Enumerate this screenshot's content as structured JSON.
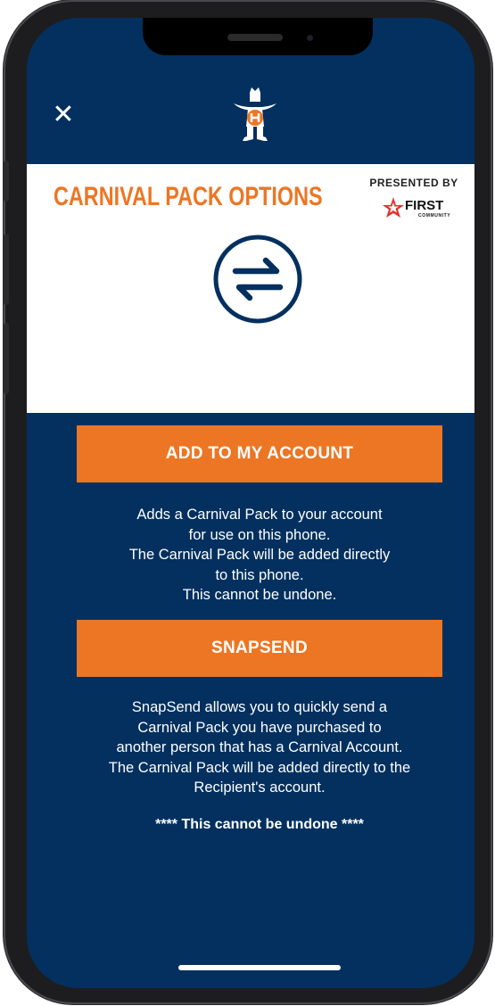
{
  "header": {
    "close_symbol": "✕"
  },
  "panel": {
    "title": "CARNIVAL PACK OPTIONS",
    "presented_by": "PRESENTED BY",
    "sponsor_name": "FIRST",
    "sponsor_sub": "COMMUNITY"
  },
  "add_to_account": {
    "button_label": "ADD TO MY ACCOUNT",
    "description": [
      "Adds a Carnival Pack to your account",
      "for use on this phone.",
      "The Carnival Pack will be added directly",
      "to this phone.",
      "This cannot be undone."
    ]
  },
  "snapsend": {
    "button_label": "SNAPSEND",
    "description": [
      "SnapSend allows you to quickly send a",
      "Carnival Pack you have purchased to",
      "another person that has a Carnival Account.",
      "The Carnival Pack will be added directly to the",
      "Recipient's account."
    ]
  },
  "warning": "**** This cannot be undone ****",
  "colors": {
    "navy": "#03305f",
    "orange": "#ec7624",
    "white": "#ffffff"
  },
  "icons": [
    "close-icon",
    "rodeo-logo-icon",
    "swap-arrows-icon",
    "sponsor-star-icon"
  ]
}
